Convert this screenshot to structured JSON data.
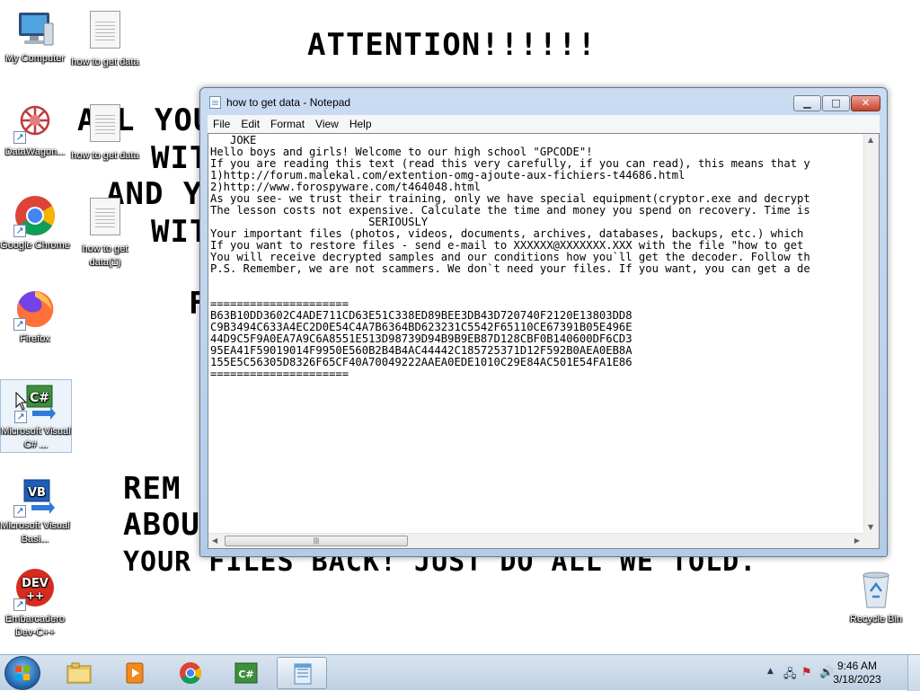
{
  "wallpaper": {
    "title": "ATTENTION!!!!!!",
    "lines_top": [
      "A L YOU",
      "WIT",
      "AND Y",
      "WIT",
      "F"
    ],
    "lines_bottom": [
      "REM",
      "ABOU",
      "YOUR FILES BACK! JUST DO ALL WE TOLD."
    ]
  },
  "desktop_icons": [
    {
      "label": "My Computer",
      "icon": "computer-icon"
    },
    {
      "label": "how to get data",
      "icon": "text-file-icon"
    },
    {
      "label": "DataWagon...",
      "icon": "datawagon-icon"
    },
    {
      "label": "how to get data",
      "icon": "text-file-icon"
    },
    {
      "label": "Google Chrome",
      "icon": "chrome-icon"
    },
    {
      "label": "how to get data(1)",
      "icon": "text-file-icon"
    },
    {
      "label": "Firefox",
      "icon": "firefox-icon"
    },
    {
      "label": "Microsoft Visual C# ...",
      "icon": "visual-csharp-icon"
    },
    {
      "label": "Microsoft Visual Basi...",
      "icon": "visual-basic-icon"
    },
    {
      "label": "Embarcadero Dev-C++",
      "icon": "devcpp-icon"
    },
    {
      "label": "Recycle Bin",
      "icon": "recycle-bin-icon"
    }
  ],
  "notepad": {
    "title": "how to get data - Notepad",
    "menu": [
      "File",
      "Edit",
      "Format",
      "View",
      "Help"
    ],
    "lines": [
      "   JOKE",
      "Hello boys and girls! Welcome to our high school \"GPCODE\"!",
      "If you are reading this text (read this very carefully, if you can read), this means that y",
      "1)http://forum.malekal.com/extention-omg-ajoute-aux-fichiers-t44686.html",
      "2)http://www.forospyware.com/t464048.html",
      "As you see- we trust their training, only we have special equipment(cryptor.exe and decrypt",
      "The lesson costs not expensive. Calculate the time and money you spend on recovery. Time is",
      "                        SERIOUSLY",
      "Your important files (photos, videos, documents, archives, databases, backups, etc.) which",
      "If you want to restore files - send e-mail to XXXXXX@XXXXXXX.XXX with the file \"how to get",
      "You will receive decrypted samples and our conditions how you`ll get the decoder. Follow th",
      "P.S. Remember, we are not scammers. We don`t need your files. If you want, you can get a de",
      "",
      "",
      "=====================",
      "B63B10DD3602C4ADE711CD63E51C338ED89BEE3DB43D720740F2120E13803DD8",
      "C9B3494C633A4EC2D0E54C4A7B6364BD623231C5542F65110CE67391B05E496E",
      "44D9C5F9A0EA7A9C6A8551E513D98739D94B9B9EB87D128CBF0B140600DF6CD3",
      "95EA41F59019014F9950E560B2B4B4AC44442C185725371D12F592B0AEA0EB8A",
      "155E5C56305D8326F65CF40A70049222AAEA0EDE1010C29E84AC501E54FA1E86",
      "====================="
    ]
  },
  "taskbar": {
    "items": [
      "windows-explorer-icon",
      "media-player-icon",
      "chrome-icon",
      "visual-csharp-icon",
      "notepad-icon"
    ],
    "time": "9:46 AM",
    "date": "3/18/2023"
  }
}
